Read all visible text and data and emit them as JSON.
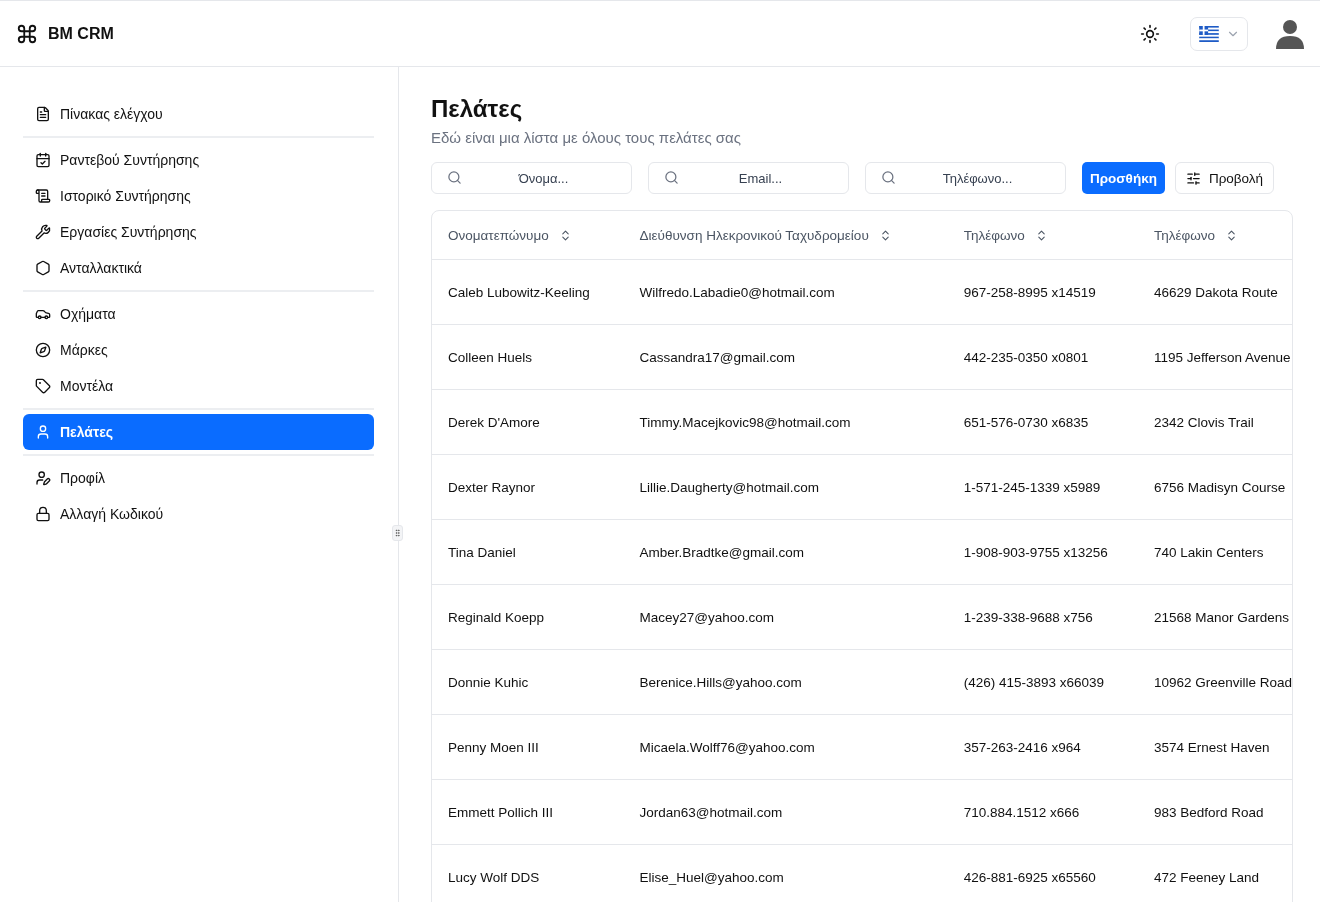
{
  "header": {
    "app_name": "BM CRM"
  },
  "sidebar": {
    "groups": [
      {
        "items": [
          {
            "label": "Πίνακας ελέγχου",
            "selected": false
          }
        ]
      },
      {
        "items": [
          {
            "label": "Ραντεβού Συντήρησης",
            "selected": false
          },
          {
            "label": "Ιστορικό Συντήρησης",
            "selected": false
          },
          {
            "label": "Εργασίες Συντήρησης",
            "selected": false
          },
          {
            "label": "Ανταλλακτικά",
            "selected": false
          }
        ]
      },
      {
        "items": [
          {
            "label": "Οχήματα",
            "selected": false
          },
          {
            "label": "Μάρκες",
            "selected": false
          },
          {
            "label": "Μοντέλα",
            "selected": false
          }
        ]
      },
      {
        "items": [
          {
            "label": "Πελάτες",
            "selected": true
          }
        ]
      },
      {
        "items": [
          {
            "label": "Προφίλ",
            "selected": false
          },
          {
            "label": "Αλλαγή Κωδικού",
            "selected": false
          }
        ]
      }
    ]
  },
  "page": {
    "title": "Πελάτες",
    "subtitle": "Εδώ είναι μια λίστα με όλους τους πελάτες σας"
  },
  "filters": [
    {
      "placeholder": "Όνομα..."
    },
    {
      "placeholder": "Email..."
    },
    {
      "placeholder": "Τηλέφωνο..."
    }
  ],
  "actions": {
    "add": "Προσθήκη",
    "view": "Προβολή"
  },
  "table": {
    "columns": [
      "Ονοματεπώνυμο",
      "Διεύθυνση Ηλεκρονικού Ταχυδρομείου",
      "Τηλέφωνο",
      "Τηλέφωνο"
    ],
    "rows": [
      [
        "Caleb Lubowitz-Keeling",
        "Wilfredo.Labadie0@hotmail.com",
        "967-258-8995 x14519",
        "46629 Dakota Route"
      ],
      [
        "Colleen Huels",
        "Cassandra17@gmail.com",
        "442-235-0350 x0801",
        "1195 Jefferson Avenue"
      ],
      [
        "Derek D'Amore",
        "Timmy.Macejkovic98@hotmail.com",
        "651-576-0730 x6835",
        "2342 Clovis Trail"
      ],
      [
        "Dexter Raynor",
        "Lillie.Daugherty@hotmail.com",
        "1-571-245-1339 x5989",
        "6756 Madisyn Course"
      ],
      [
        "Tina Daniel",
        "Amber.Bradtke@gmail.com",
        "1-908-903-9755 x13256",
        "740 Lakin Centers"
      ],
      [
        "Reginald Koepp",
        "Macey27@yahoo.com",
        "1-239-338-9688 x756",
        "21568 Manor Gardens"
      ],
      [
        "Donnie Kuhic",
        "Berenice.Hills@yahoo.com",
        "(426) 415-3893 x66039",
        "10962 Greenville Road"
      ],
      [
        "Penny Moen III",
        "Micaela.Wolff76@yahoo.com",
        "357-263-2416 x964",
        "3574 Ernest Haven"
      ],
      [
        "Emmett Pollich III",
        "Jordan63@hotmail.com",
        "710.884.1512 x666",
        "983 Bedford Road"
      ],
      [
        "Lucy Wolf DDS",
        "Elise_Huel@yahoo.com",
        "426-881-6925 x65560",
        "472 Feeney Land"
      ]
    ]
  }
}
